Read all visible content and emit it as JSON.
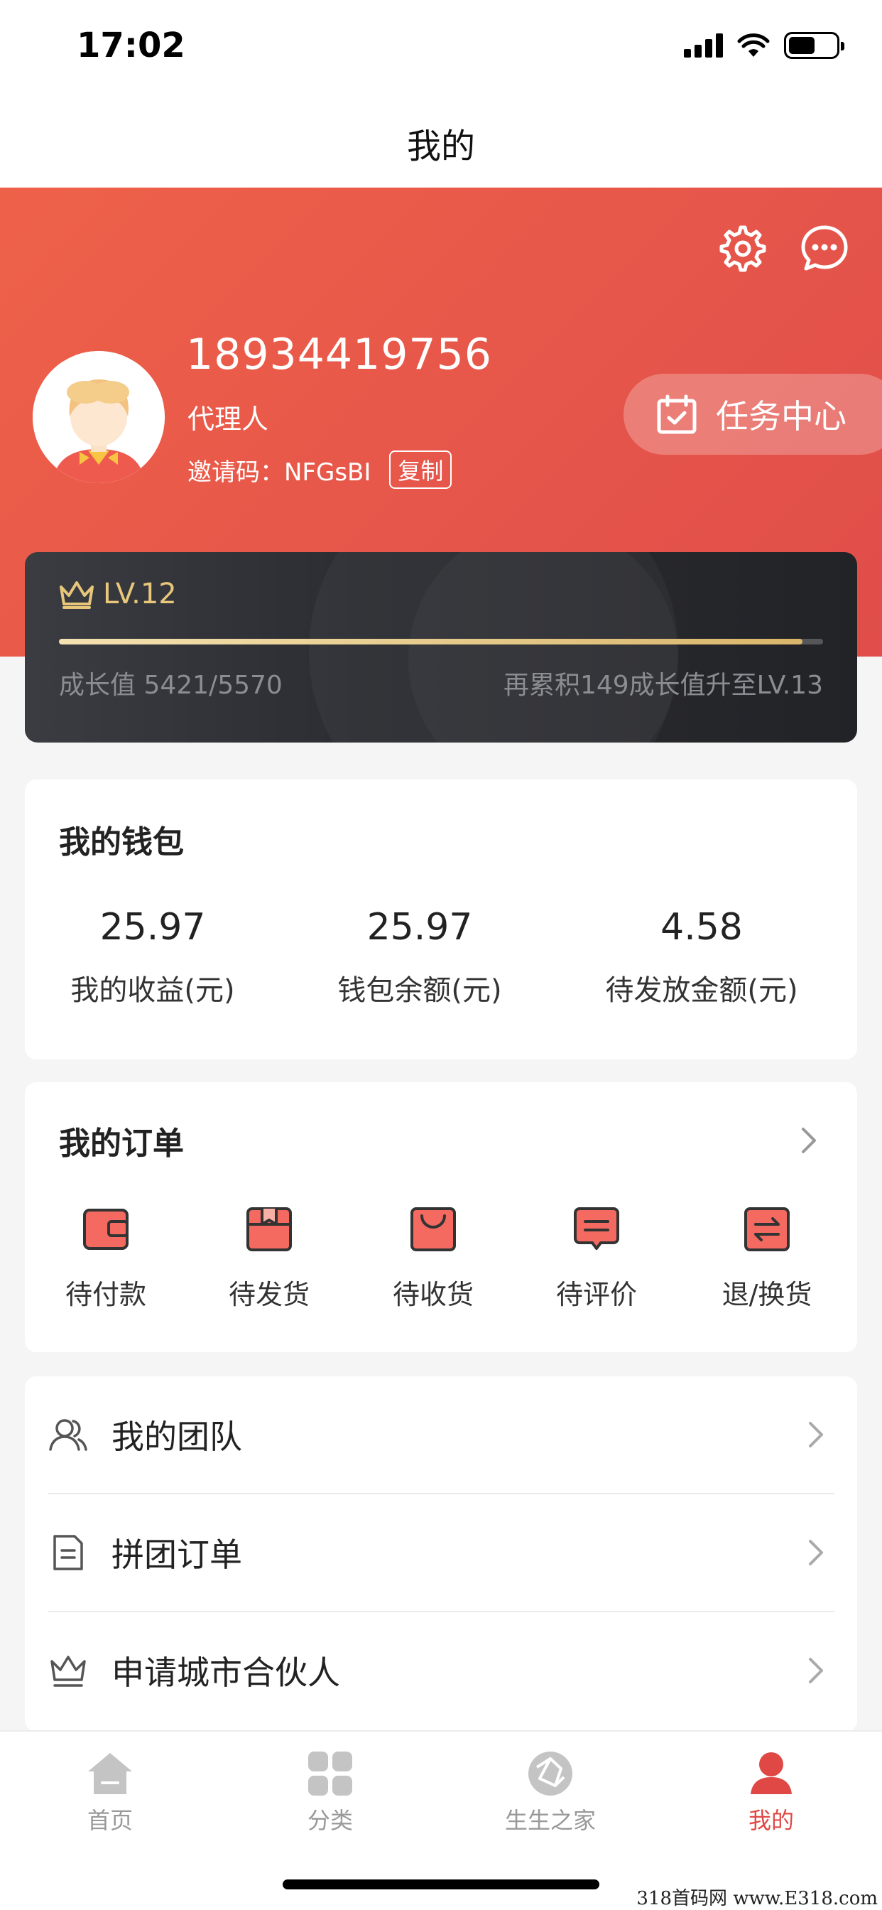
{
  "status_bar": {
    "time": "17:02"
  },
  "nav": {
    "title": "我的"
  },
  "profile": {
    "phone": "18934419756",
    "role": "代理人",
    "invite_code": "邀请码：NFGsBI",
    "copy_label": "复制",
    "task_center_label": "任务中心"
  },
  "level": {
    "label": "LV.12",
    "growth_text": "成长值 5421/5570",
    "next_text": "再累积149成长值升至LV.13",
    "current": 5421,
    "target": 5570
  },
  "wallet": {
    "title": "我的钱包",
    "stats": [
      {
        "value": "25.97",
        "label": "我的收益(元)"
      },
      {
        "value": "25.97",
        "label": "钱包余额(元)"
      },
      {
        "value": "4.58",
        "label": "待发放金额(元)"
      }
    ]
  },
  "orders": {
    "title": "我的订单",
    "items": [
      {
        "label": "待付款",
        "icon": "wallet-icon"
      },
      {
        "label": "待发货",
        "icon": "package-icon"
      },
      {
        "label": "待收货",
        "icon": "bag-icon"
      },
      {
        "label": "待评价",
        "icon": "comment-icon"
      },
      {
        "label": "退/换货",
        "icon": "exchange-icon"
      }
    ]
  },
  "menu": {
    "items": [
      {
        "label": "我的团队",
        "icon": "team-icon"
      },
      {
        "label": "拼团订单",
        "icon": "document-icon"
      },
      {
        "label": "申请城市合伙人",
        "icon": "crown-icon"
      }
    ]
  },
  "tabbar": {
    "items": [
      {
        "label": "首页",
        "icon": "home-icon"
      },
      {
        "label": "分类",
        "icon": "category-icon"
      },
      {
        "label": "生生之家",
        "icon": "shutter-icon"
      },
      {
        "label": "我的",
        "icon": "user-icon",
        "active": true
      }
    ]
  },
  "colors": {
    "brand_red": "#e04d4a",
    "gold": "#e8c77a"
  },
  "watermark": "318首码网  www.E318.com"
}
